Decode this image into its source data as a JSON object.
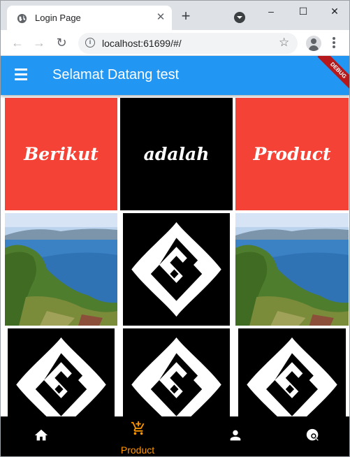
{
  "browser": {
    "tab_title": "Login Page",
    "tab_close": "✕",
    "new_tab": "+",
    "url": "localhost:61699/#/",
    "window_controls": [
      "–",
      "☐",
      "✕"
    ]
  },
  "app": {
    "title": "Selamat Datang test",
    "debug_banner": "DEBUG",
    "words": [
      "Berikut",
      "adalah",
      "Product"
    ],
    "bottom_nav": {
      "items": [
        "home-icon",
        "cart-icon",
        "person-icon",
        "search-settings-icon"
      ],
      "active_label": "Product"
    },
    "colors": {
      "appbar": "#2196f3",
      "tile_red": "#f44336",
      "tile_black": "#000000",
      "nav_active": "#ff9800"
    }
  }
}
